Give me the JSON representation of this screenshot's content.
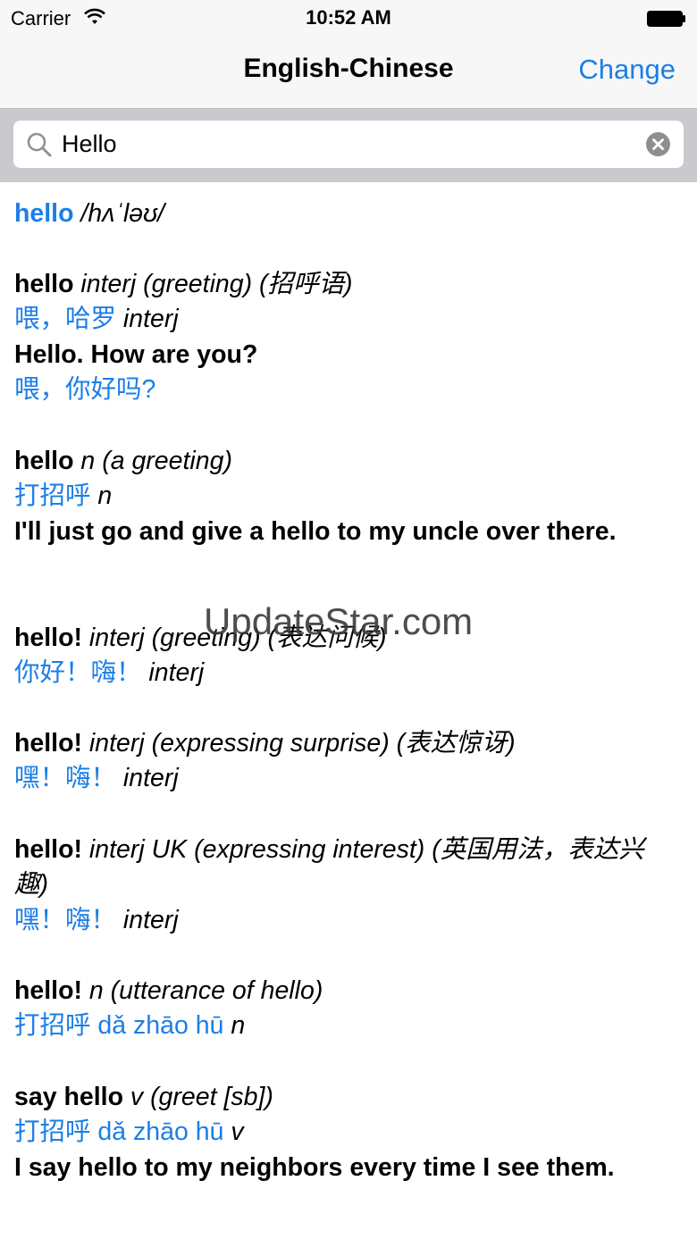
{
  "status_bar": {
    "carrier": "Carrier",
    "time": "10:52 AM"
  },
  "nav": {
    "title": "English-Chinese",
    "change_label": "Change"
  },
  "search": {
    "value": "Hello"
  },
  "watermark": "UpdateStar.com",
  "entries": {
    "e0": {
      "head": "hello",
      "pron": " /hʌˈləʊ/"
    },
    "e1": {
      "head": "hello",
      "gram": " interj (greeting)  (招呼语)",
      "cn": "喂，哈罗",
      "cn_pos": " interj",
      "ex": "Hello. How are you?",
      "ex_cn": "喂，你好吗?"
    },
    "e2": {
      "head": "hello",
      "gram": " n (a greeting)",
      "cn": "打招呼",
      "cn_pos": " n",
      "ex": "I'll just go and give a hello to my uncle over there."
    },
    "e3": {
      "head": "hello!",
      "gram": " interj (greeting)  (表达问候)",
      "cn": "你好！嗨！",
      "cn_pos": " interj"
    },
    "e4": {
      "head": "hello!",
      "gram": " interj (expressing surprise)  (表达惊讶)",
      "cn": "嘿！嗨！",
      "cn_pos": " interj"
    },
    "e5": {
      "head": "hello!",
      "gram": " interj UK (expressing interest)  (英国用法，表达兴",
      "gram2": "趣)",
      "cn": "嘿！嗨！",
      "cn_pos": " interj"
    },
    "e6": {
      "head": "hello!",
      "gram": " n (utterance of hello)",
      "cn": "打招呼 dǎ zhāo hū",
      "cn_pos": " n"
    },
    "e7": {
      "head": "say hello",
      "gram": " v (greet [sb])",
      "cn": "打招呼 dǎ zhāo hū",
      "cn_pos": " v",
      "ex": "I say hello to my neighbors every time I see them."
    }
  },
  "icons": {
    "wifi": "wifi-icon",
    "battery": "battery-icon",
    "search": "search-icon",
    "clear": "clear-icon"
  },
  "colors": {
    "accent": "#1c7ee6",
    "bar_bg": "#f7f7f7",
    "search_bg": "#c9c9ce"
  }
}
